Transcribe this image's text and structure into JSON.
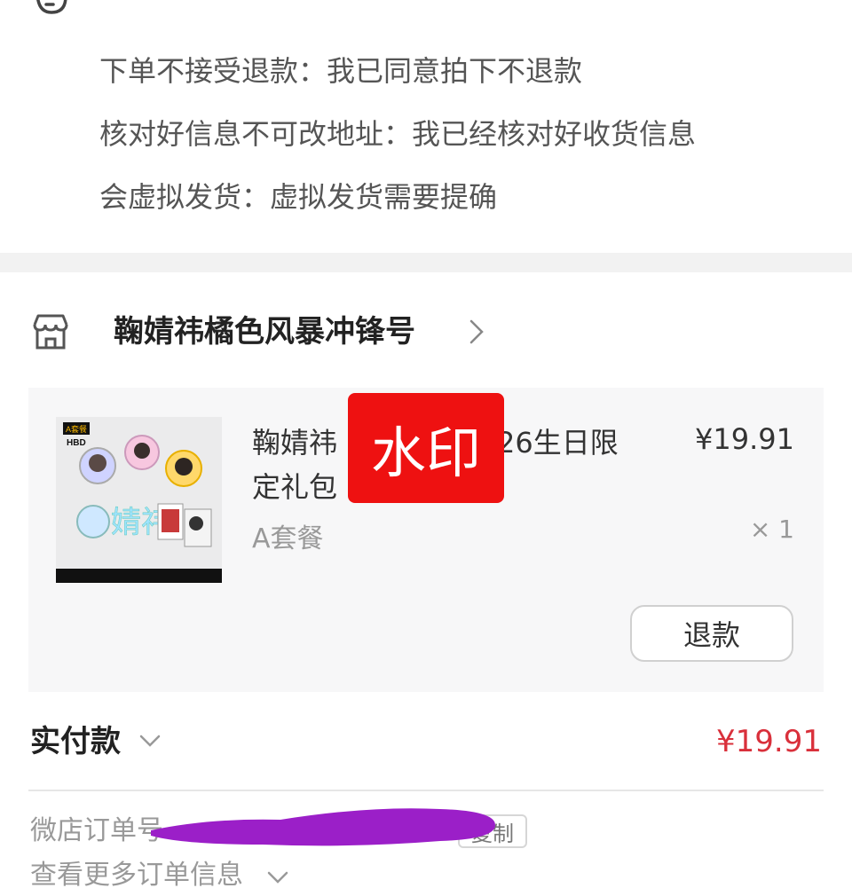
{
  "notes": [
    {
      "text": "下单不接受退款：我已同意拍下不退款"
    },
    {
      "text": "核对好信息不可改地址：我已经核对好收货信息"
    },
    {
      "text": "会虚拟发货：虚拟发货需要提确"
    }
  ],
  "store": {
    "name": "鞠婧祎橘色风暴冲锋号",
    "icon": "storefront-icon"
  },
  "product": {
    "title_part1": "鞠婧祎",
    "title_part2": "26生日限定礼包",
    "price": "¥19.91",
    "variant": "A套餐",
    "quantity": "× 1",
    "refund_label": "退款",
    "watermark": "水印",
    "thumb": {
      "badge": "A套餐",
      "hbd": "HBD",
      "big_chars": "婧祎"
    }
  },
  "payment": {
    "label": "实付款",
    "amount": "¥19.91",
    "amount_color": "#d9303b"
  },
  "order": {
    "label": "微店订单号",
    "copy_label": "复制",
    "more_label": "查看更多订单信息"
  },
  "colors": {
    "redaction": "#9b1fc8",
    "watermark": "#ee1111"
  }
}
